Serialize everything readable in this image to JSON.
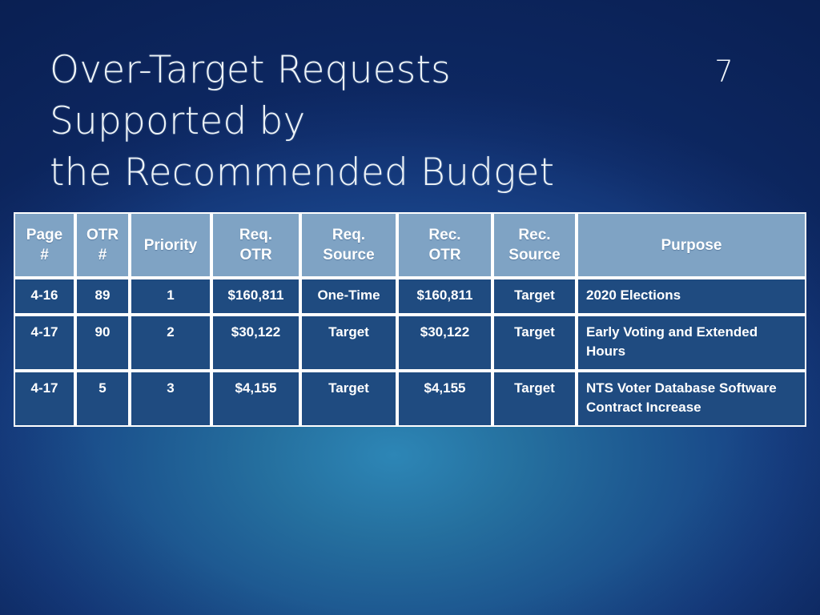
{
  "slide": {
    "number": "7",
    "title_lines": [
      "Over-Target Requests Supported by",
      "the Recommended Budget"
    ],
    "title_line_1": "Over-Target Requests",
    "title_line_2": "Supported by",
    "title_line_3": "the Recommended Budget",
    "background_color": "#0f2f7a",
    "accent_color": "#2d86b6"
  },
  "table": {
    "header_bg": "#7fa3c4",
    "body_bg": "#1f4b80",
    "border_color": "#ffffff",
    "columns": [
      {
        "line1": "Page",
        "line2": "#"
      },
      {
        "line1": "OTR",
        "line2": "#"
      },
      {
        "line1": "",
        "line2": "Priority"
      },
      {
        "line1": "Req.",
        "line2": "OTR"
      },
      {
        "line1": "Req.",
        "line2": "Source"
      },
      {
        "line1": "Rec.",
        "line2": "OTR"
      },
      {
        "line1": "Rec.",
        "line2": "Source"
      },
      {
        "line1": "",
        "line2": "Purpose"
      }
    ],
    "rows": [
      {
        "page": "4-16",
        "otr_number": "89",
        "priority": "1",
        "req_otr": "$160,811",
        "req_source": "One-Time",
        "rec_otr": "$160,811",
        "rec_source": "Target",
        "purpose": "2020 Elections"
      },
      {
        "page": "4-17",
        "otr_number": "90",
        "priority": "2",
        "req_otr": "$30,122",
        "req_source": "Target",
        "rec_otr": "$30,122",
        "rec_source": "Target",
        "purpose": "Early Voting and Extended Hours"
      },
      {
        "page": "4-17",
        "otr_number": "5",
        "priority": "3",
        "req_otr": "$4,155",
        "req_source": "Target",
        "rec_otr": "$4,155",
        "rec_source": "Target",
        "purpose": "NTS Voter Database Software Contract Increase"
      }
    ]
  }
}
